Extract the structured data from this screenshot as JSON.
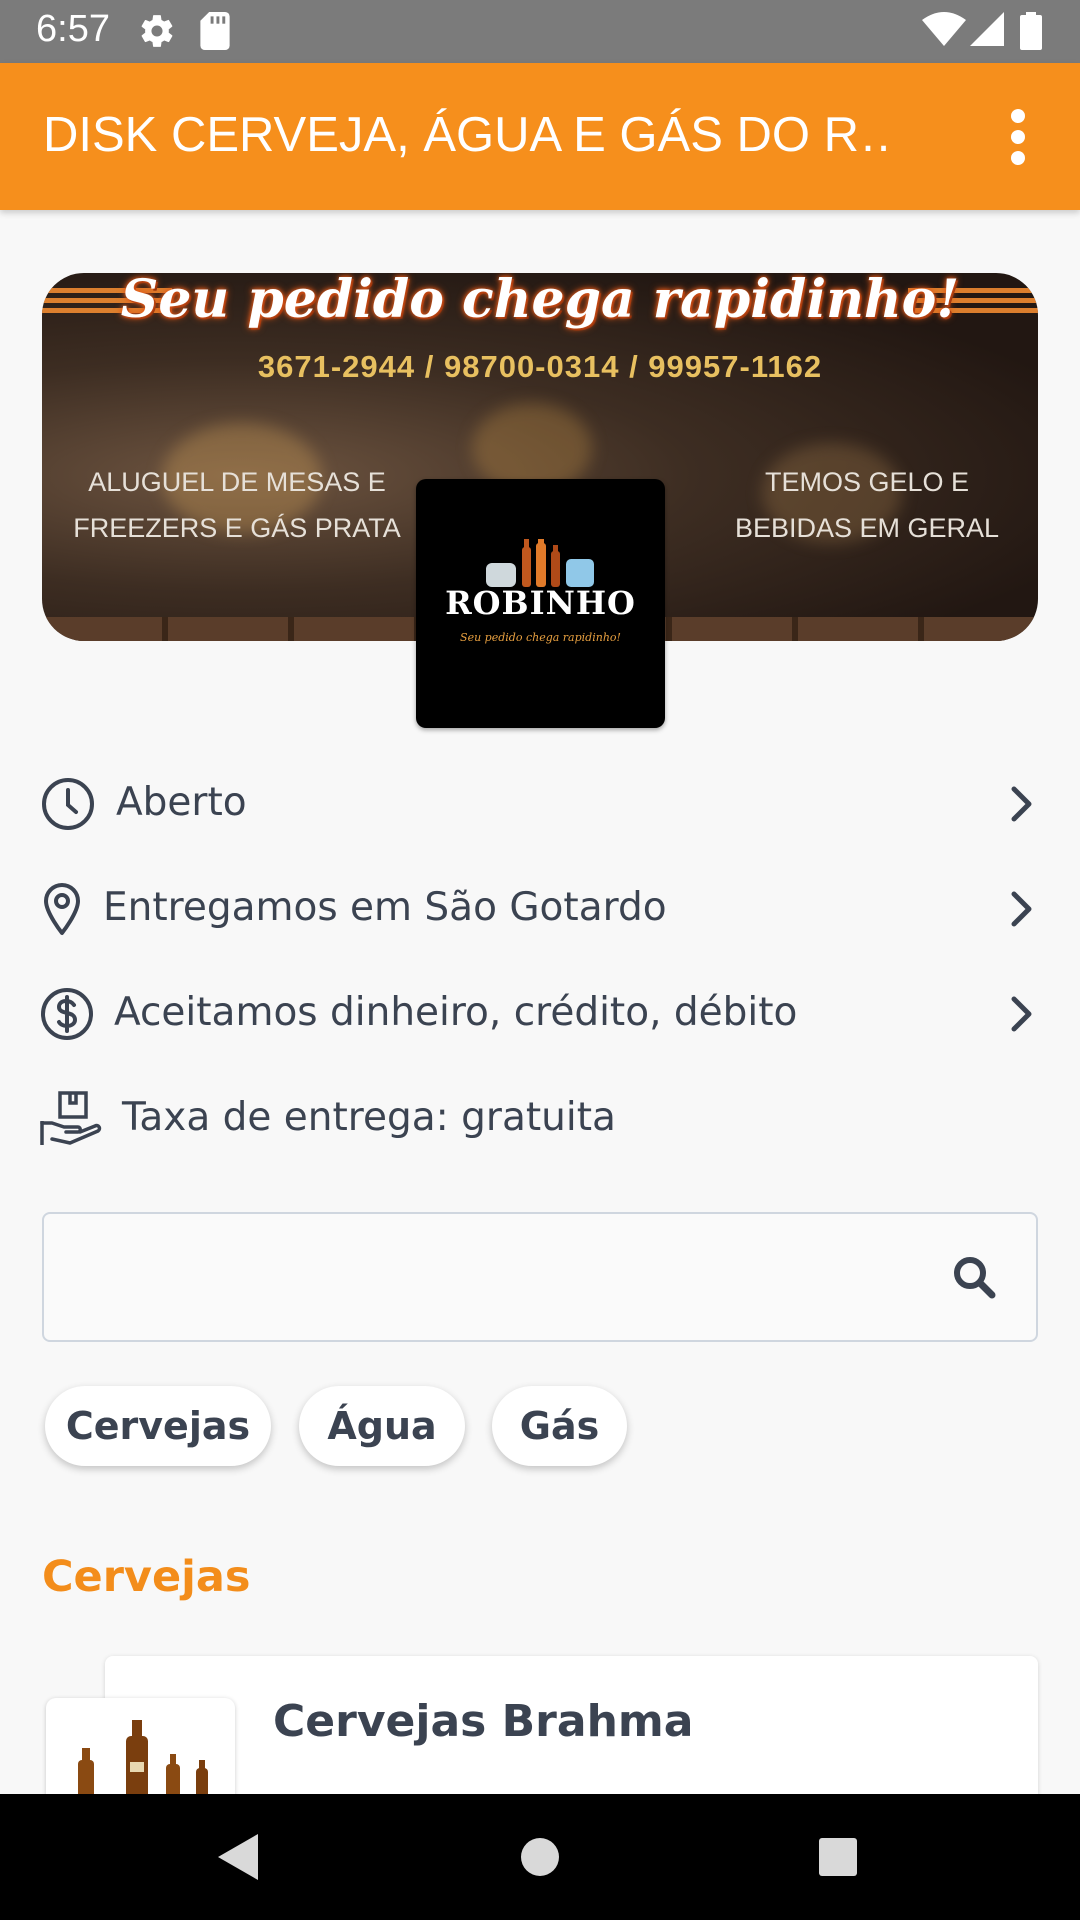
{
  "status_bar": {
    "time": "6:57",
    "icons": [
      "settings-icon",
      "sd-card-icon",
      "wifi-icon",
      "signal-icon",
      "battery-icon"
    ]
  },
  "app_bar": {
    "title": "DISK CERVEJA, ÁGUA E GÁS DO R…",
    "menu_icon": "more-vert-icon",
    "color": "#f68f1c"
  },
  "banner": {
    "slogan": "Seu pedido chega rapidinho!",
    "phones": "3671-2944 / 98700-0314 / 99957-1162",
    "left_text": "ALUGUEL DE MESAS E\nFREEZERS E GÁS PRATA",
    "right_text": "TEMOS GELO E\nBEBIDAS EM GERAL"
  },
  "logo": {
    "brand": "ROBINHO",
    "slogan": "Seu pedido chega rapidinho!"
  },
  "info": {
    "status": "Aberto",
    "delivery_area": "Entregamos em São Gotardo",
    "payment": "Aceitamos dinheiro, crédito, débito",
    "delivery_fee": "Taxa de entrega: gratuita"
  },
  "search": {
    "placeholder": "",
    "value": ""
  },
  "categories": [
    "Cervejas",
    "Água",
    "Gás"
  ],
  "section": {
    "title": "Cervejas",
    "accent": "#f38d1b"
  },
  "product": {
    "name": "Cervejas Brahma"
  },
  "nav_bar": {
    "icons": [
      "back-icon",
      "home-icon",
      "recents-icon"
    ]
  }
}
